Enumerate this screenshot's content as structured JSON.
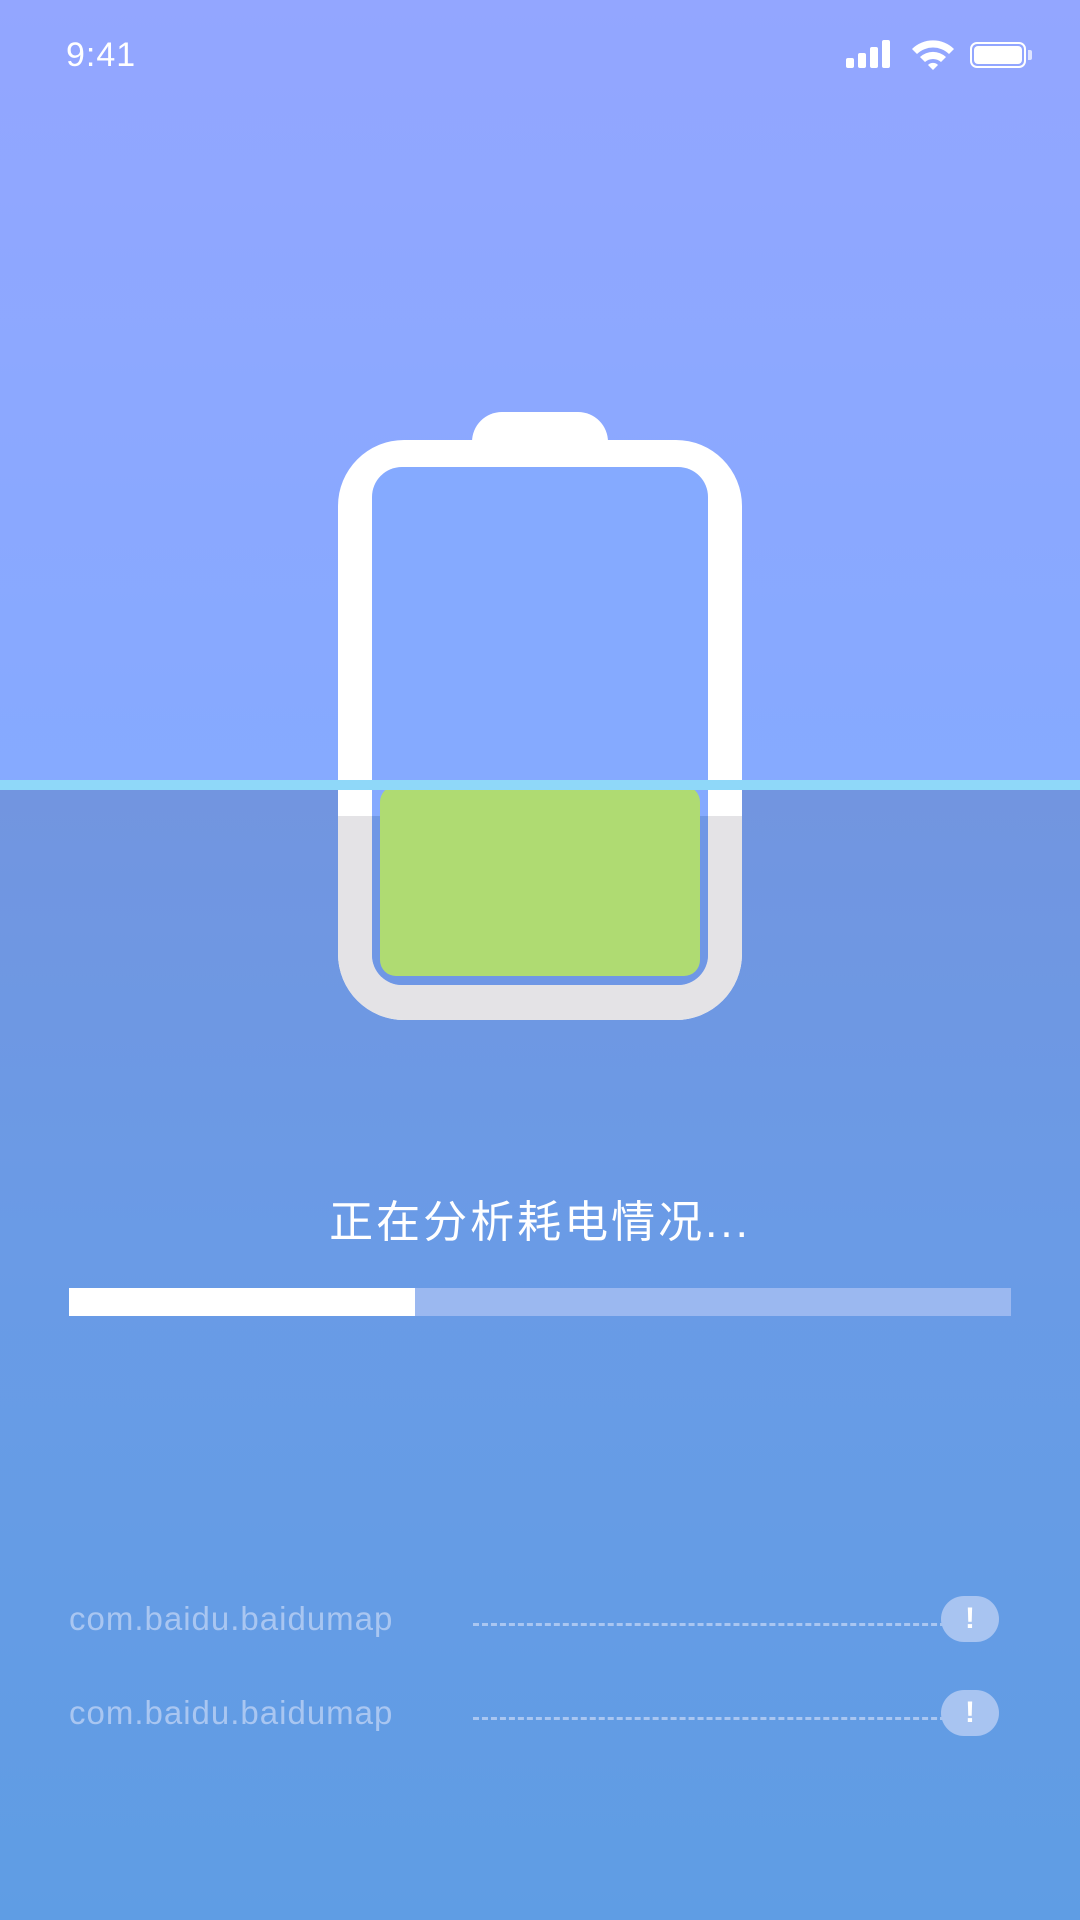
{
  "status_bar": {
    "time": "9:41"
  },
  "scan": {
    "status_text": "正在分析耗电情况...",
    "progress": 0.367
  },
  "app_list": [
    {
      "package": "com.baidu.baidumap",
      "badge": "!"
    },
    {
      "package": "com.baidu.baidumap",
      "badge": "!"
    }
  ],
  "colors": {
    "battery_level": "#afdb72",
    "scan_line": "#8fd8f9",
    "progress_fill": "#ffffff",
    "progress_track": "#9bb8f0"
  }
}
